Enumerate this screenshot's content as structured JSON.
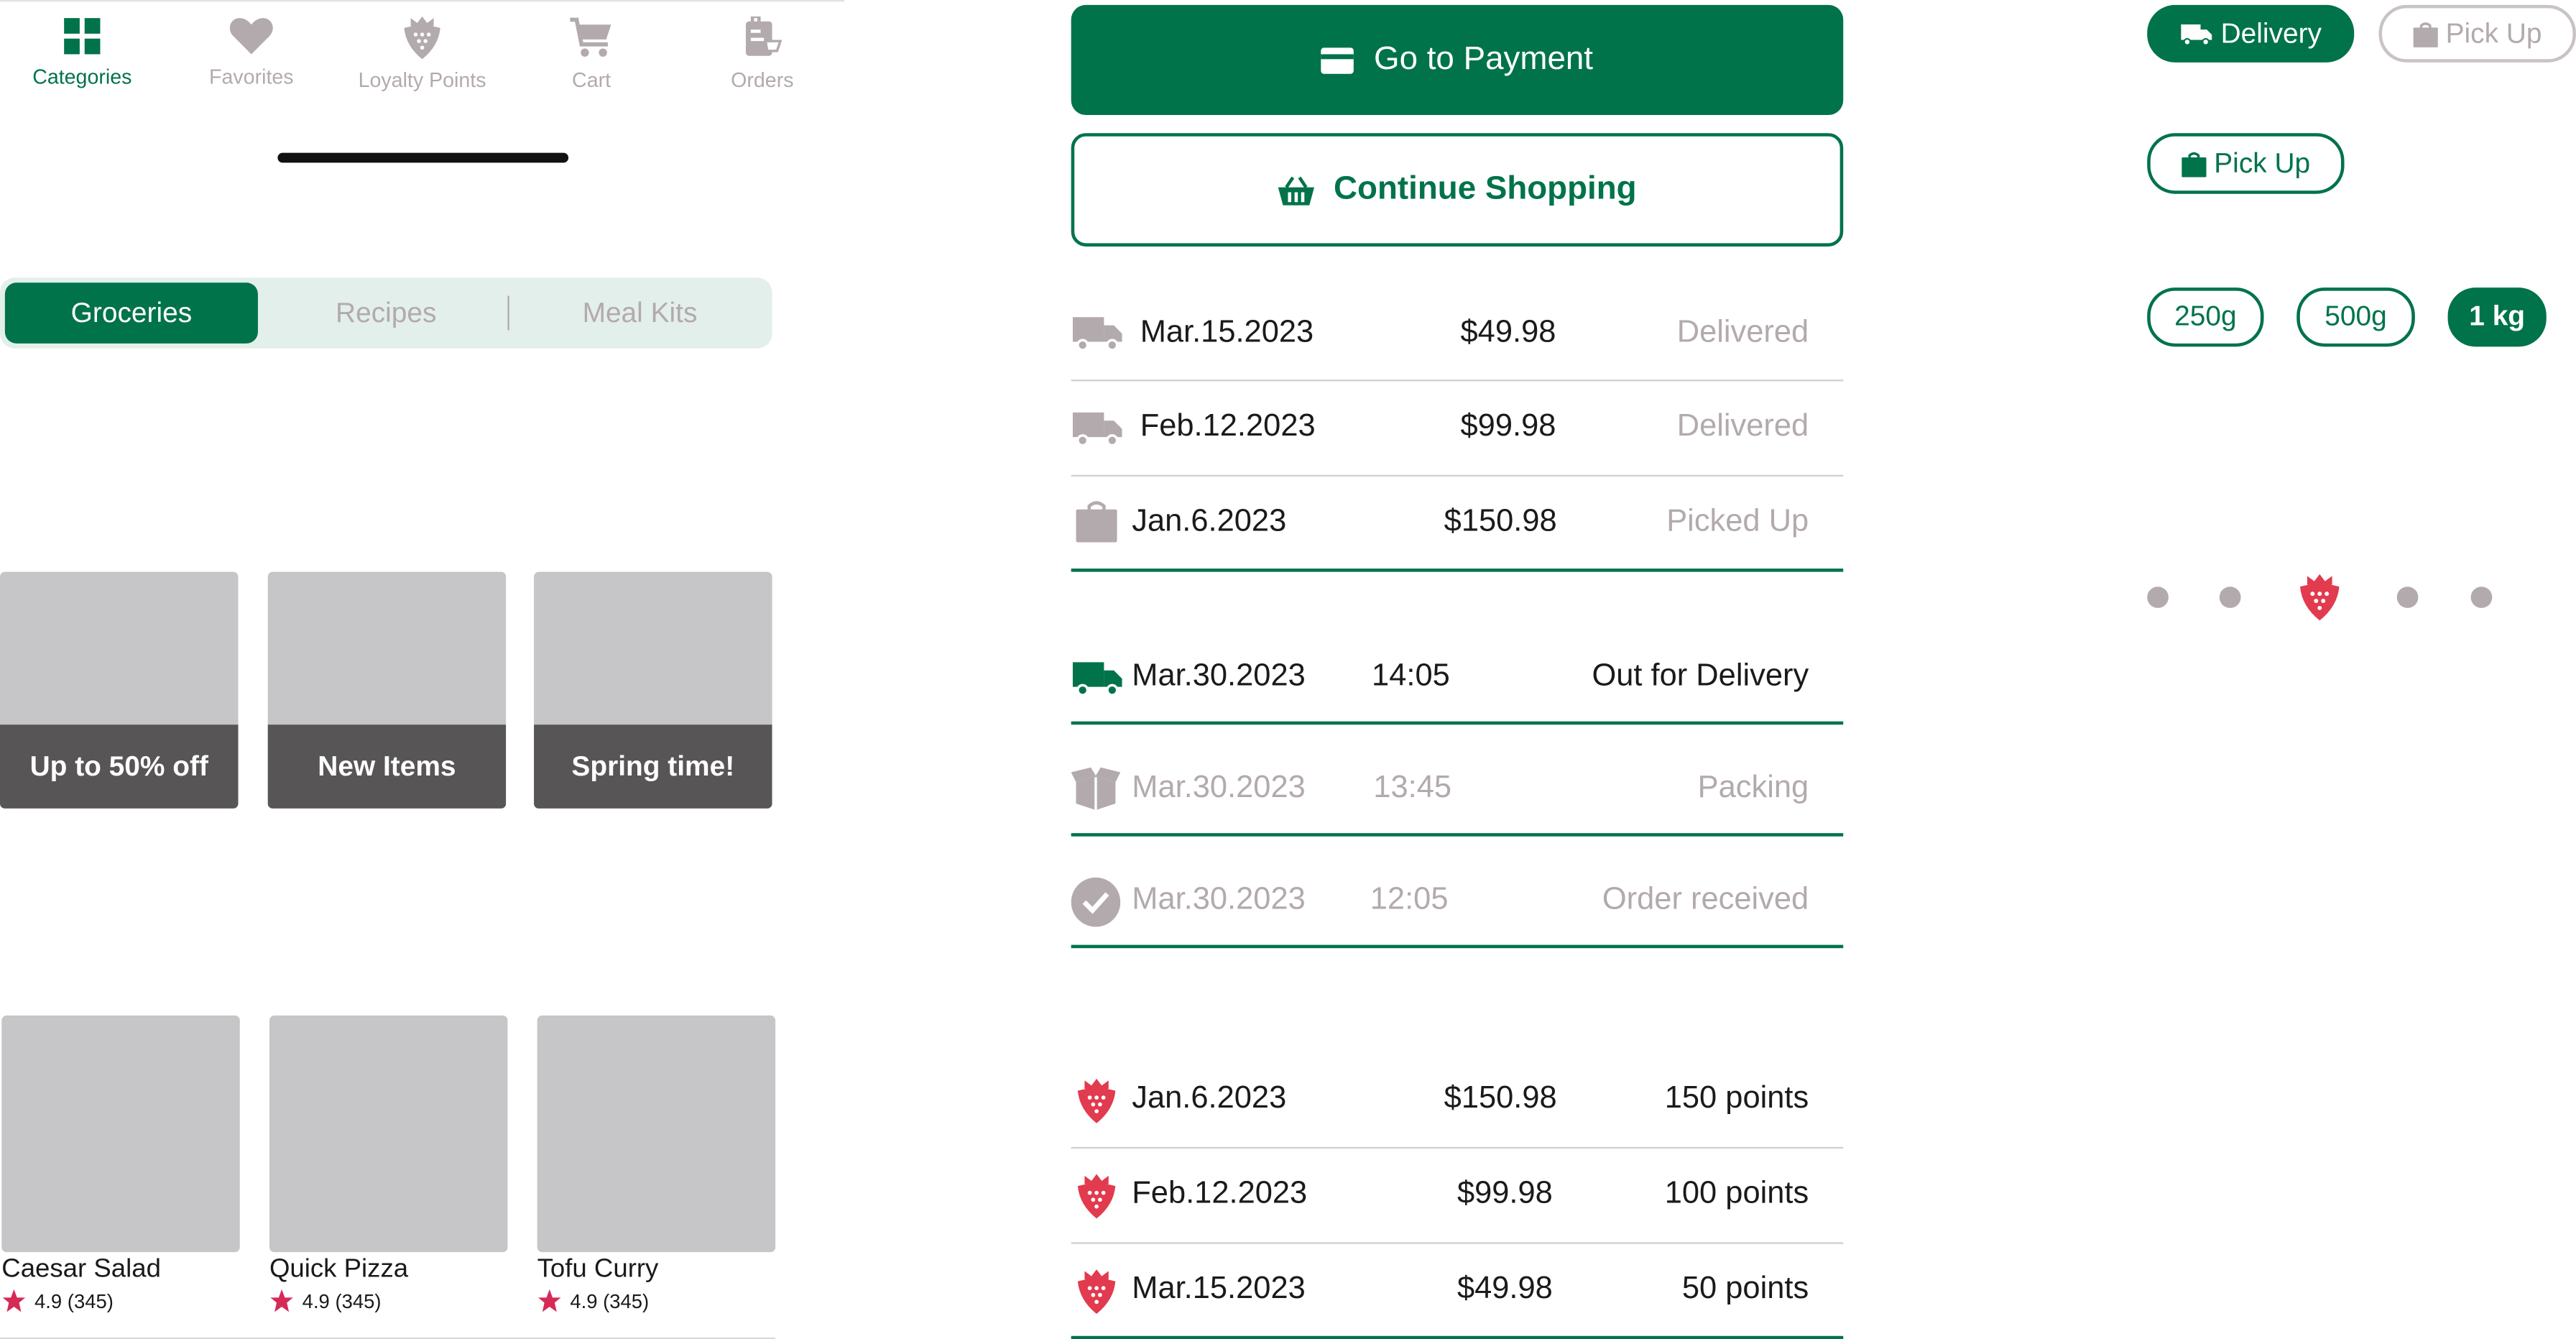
{
  "colors": {
    "primary": "#00734a",
    "inactive": "#b3aaad",
    "accent": "#e23a4e",
    "star": "#d62a56",
    "card": "#c6c6c8",
    "band": "#575556"
  },
  "nav": {
    "items": [
      {
        "label": "Categories",
        "icon": "grid-icon",
        "active": true
      },
      {
        "label": "Favorites",
        "icon": "heart-icon",
        "active": false
      },
      {
        "label": "Loyalty Points",
        "icon": "strawberry-icon",
        "active": false
      },
      {
        "label": "Cart",
        "icon": "cart-icon",
        "active": false
      },
      {
        "label": "Orders",
        "icon": "orders-icon",
        "active": false
      }
    ]
  },
  "segments": {
    "items": [
      "Groceries",
      "Recipes",
      "Meal Kits"
    ],
    "selected": "Groceries"
  },
  "promos": [
    {
      "label": "Up to 50% off"
    },
    {
      "label": "New Items"
    },
    {
      "label": "Spring time!"
    }
  ],
  "recipes": [
    {
      "name": "Caesar Salad",
      "rating": "4.9",
      "count": "(345)"
    },
    {
      "name": "Quick Pizza",
      "rating": "4.9",
      "count": "(345)"
    },
    {
      "name": "Tofu Curry",
      "rating": "4.9",
      "count": "(345)"
    }
  ],
  "buttons": {
    "payment": "Go to Payment",
    "continue": "Continue Shopping"
  },
  "orders": [
    {
      "date": "Mar.15.2023",
      "amount": "$49.98",
      "status": "Delivered",
      "icon": "truck-icon"
    },
    {
      "date": "Feb.12.2023",
      "amount": "$99.98",
      "status": "Delivered",
      "icon": "truck-icon"
    },
    {
      "date": "Jan.6.2023",
      "amount": "$150.98",
      "status": "Picked Up",
      "icon": "bag-icon"
    }
  ],
  "tracking": [
    {
      "date": "Mar.30.2023",
      "time": "14:05",
      "status": "Out for Delivery",
      "icon": "truck-icon",
      "active": true
    },
    {
      "date": "Mar.30.2023",
      "time": "13:45",
      "status": "Packing",
      "icon": "box-icon",
      "active": false
    },
    {
      "date": "Mar.30.2023",
      "time": "12:05",
      "status": "Order received",
      "icon": "check-circle-icon",
      "active": false
    }
  ],
  "points": [
    {
      "date": "Jan.6.2023",
      "amount": "$150.98",
      "points": "150 points"
    },
    {
      "date": "Feb.12.2023",
      "amount": "$99.98",
      "points": "100 points"
    },
    {
      "date": "Mar.15.2023",
      "amount": "$49.98",
      "points": "50 points"
    }
  ],
  "fulfillment": {
    "delivery": "Delivery",
    "pickup": "Pick Up",
    "selected": "Delivery"
  },
  "pickup_alt": "Pick Up",
  "sizes": {
    "options": [
      "250g",
      "500g",
      "1 kg"
    ],
    "selected": "1 kg"
  },
  "pager": {
    "total": 5,
    "current": 3
  }
}
